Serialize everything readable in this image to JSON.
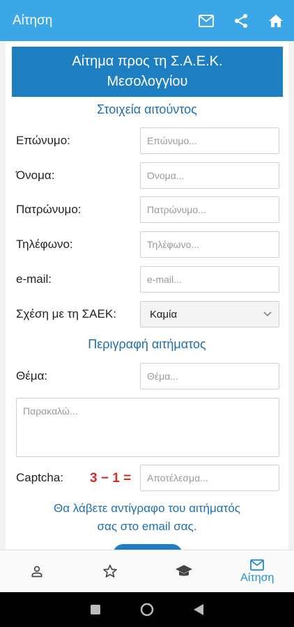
{
  "appbar": {
    "title": "Αίτηση",
    "icons": [
      "mail-icon",
      "share-icon",
      "home-icon"
    ]
  },
  "banner": {
    "line1": "Αίτημα προς τη Σ.Α.Ε.Κ.",
    "line2": "Μεσολογγίου"
  },
  "applicant_section": {
    "title": "Στοιχεία αιτούντος",
    "fields": [
      {
        "label": "Επώνυμο:",
        "placeholder": "Επώνυμο..."
      },
      {
        "label": "Όνομα:",
        "placeholder": "Όνομα..."
      },
      {
        "label": "Πατρώνυμο:",
        "placeholder": "Πατρώνυμο..."
      },
      {
        "label": "Τηλέφωνο:",
        "placeholder": "Τηλέφωνο..."
      },
      {
        "label": "e-mail:",
        "placeholder": "e-mail..."
      }
    ],
    "relation": {
      "label": "Σχέση με τη ΣΑΕΚ:",
      "selected": "Καμία"
    }
  },
  "request_section": {
    "title": "Περιγραφή αιτήματος",
    "subject": {
      "label": "Θέμα:",
      "placeholder": "Θέμα..."
    },
    "body_placeholder": "Παρακαλώ...",
    "captcha": {
      "label": "Captcha:",
      "equation": "3 − 1 =",
      "placeholder": "Αποτέλεσμα..."
    }
  },
  "note": {
    "line1": "Θα λάβετε αντίγραφο του αιτήματός",
    "line2": "σας στο email σας."
  },
  "bottom_nav": {
    "items": [
      {
        "icon": "person-icon",
        "label": ""
      },
      {
        "icon": "star-icon",
        "label": ""
      },
      {
        "icon": "graduation-cap-icon",
        "label": ""
      },
      {
        "icon": "mail-icon",
        "label": "Αίτηση",
        "active": true
      }
    ]
  },
  "colors": {
    "appbar": "#3ba7e6",
    "banner": "#1d7fc2",
    "section_title": "#1d6fb0",
    "captcha": "#d62a2a",
    "nav_active": "#1d8fd6"
  }
}
